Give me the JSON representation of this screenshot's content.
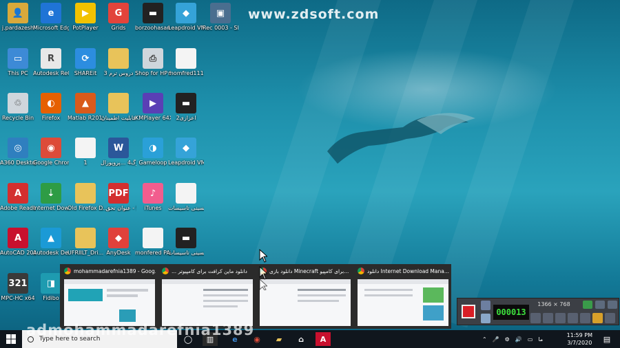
{
  "watermark": "www.zdsoft.com",
  "overlay_text": "admohammadarefnia1389",
  "desktop_icons": [
    {
      "label": "j.pardazesh",
      "icon": "user-folder-icon",
      "color": "#d9a93b",
      "glyph": "👤"
    },
    {
      "label": "Microsoft Edge",
      "icon": "edge-icon",
      "color": "#1f74d6",
      "glyph": "e"
    },
    {
      "label": "PotPlayer",
      "icon": "potplayer-icon",
      "color": "#f2c200",
      "glyph": "▶"
    },
    {
      "label": "Grids",
      "icon": "grids-icon",
      "color": "#e2443b",
      "glyph": "G"
    },
    {
      "label": "borzoohasan -94-11-5 ta...",
      "icon": "video-file-icon",
      "color": "#222222",
      "glyph": "▬"
    },
    {
      "label": "Leapdroid VM1",
      "icon": "leapdroid-icon",
      "color": "#35a3d8",
      "glyph": "◆"
    },
    {
      "label": "Rec 0003 - Shortcut",
      "icon": "recording-shortcut-icon",
      "color": "#4a6e8f",
      "glyph": "▣"
    },
    {
      "label": "This PC",
      "icon": "this-pc-icon",
      "color": "#3d8ad6",
      "glyph": "▭"
    },
    {
      "label": "Autodesk ReCap 360",
      "icon": "recap-icon",
      "color": "#e8e8e8",
      "glyph": "R"
    },
    {
      "label": "SHAREit",
      "icon": "shareit-icon",
      "color": "#2c8de0",
      "glyph": "⟳"
    },
    {
      "label": "دروس ترم 3",
      "icon": "folder-icon",
      "color": "#e8c35a",
      "glyph": ""
    },
    {
      "label": "Shop for HP Supplies",
      "icon": "printer-icon",
      "color": "#cfd6dc",
      "glyph": "⎙"
    },
    {
      "label": "momfred111 - Copy",
      "icon": "text-file-icon",
      "color": "#f4f4f4",
      "glyph": ""
    },
    {
      "label": "Recycle Bin",
      "icon": "recycle-bin-icon",
      "color": "#cfd6dc",
      "glyph": "♲"
    },
    {
      "label": "Firefox",
      "icon": "firefox-icon",
      "color": "#e66000",
      "glyph": "◐"
    },
    {
      "label": "Matlab R2019a",
      "icon": "matlab-icon",
      "color": "#d95a1b",
      "glyph": "▲"
    },
    {
      "label": "قابلیت اطمینان",
      "icon": "pdf-folder-icon",
      "color": "#e8c35a",
      "glyph": ""
    },
    {
      "label": "KMPlayer 64X",
      "icon": "kmplayer-icon",
      "color": "#5a3fb5",
      "glyph": "▶"
    },
    {
      "label": "اعزازی2",
      "icon": "video-file-icon",
      "color": "#222222",
      "glyph": "▬"
    },
    {
      "label": "A360 Desktop",
      "icon": "a360-icon",
      "color": "#2f7fbf",
      "glyph": "◎"
    },
    {
      "label": "Google Chrome",
      "icon": "chrome-icon",
      "color": "#dd4b39",
      "glyph": "◉"
    },
    {
      "label": "1",
      "icon": "blank-file-icon",
      "color": "#f4f4f4",
      "glyph": ""
    },
    {
      "label": "کاربرگ4 ...پروپوزال",
      "icon": "word-file-icon",
      "color": "#2b579a",
      "glyph": "W"
    },
    {
      "label": "Gameloop",
      "icon": "gameloop-icon",
      "color": "#2aa0d8",
      "glyph": "◑"
    },
    {
      "label": "Leapdroid VM2",
      "icon": "leapdroid-icon",
      "color": "#35a3d8",
      "glyph": "◆"
    },
    {
      "label": "Adobe Reader X",
      "icon": "adobe-reader-icon",
      "color": "#d32f2f",
      "glyph": "A"
    },
    {
      "label": "Internet Downlo...",
      "icon": "idm-icon",
      "color": "#2e9c45",
      "glyph": "⇣"
    },
    {
      "label": "Old Firefox Data",
      "icon": "folder-icon",
      "color": "#e8c35a",
      "glyph": ""
    },
    {
      "label": "...عنوان تحق - Shortcut",
      "icon": "pdf-shortcut-icon",
      "color": "#d32f2f",
      "glyph": "PDF"
    },
    {
      "label": "iTunes",
      "icon": "itunes-icon",
      "color": "#f25d8e",
      "glyph": "♪"
    },
    {
      "label": "اقای حسینی تاسیسات.bak",
      "icon": "blank-file-icon",
      "color": "#f4f4f4",
      "glyph": ""
    },
    {
      "label": "AutoCAD 2017 - E...",
      "icon": "autocad-icon",
      "color": "#c8102e",
      "glyph": "A"
    },
    {
      "label": "Autodesk Desktop App",
      "icon": "autodesk-app-icon",
      "color": "#1b9ad6",
      "glyph": "▲"
    },
    {
      "label": "UFRIILT_Dri...",
      "icon": "folder-icon",
      "color": "#e8c35a",
      "glyph": ""
    },
    {
      "label": "AnyDesk",
      "icon": "anydesk-icon",
      "color": "#e0413b",
      "glyph": "◆"
    },
    {
      "label": "monfered PARSIAN.bak",
      "icon": "blank-file-icon",
      "color": "#f4f4f4",
      "glyph": ""
    },
    {
      "label": "اقای حسینی تاسیسات",
      "icon": "video-file-icon",
      "color": "#222222",
      "glyph": "▬"
    },
    {
      "label": "MPC-HC x64",
      "icon": "mpc-hc-icon",
      "color": "#3a3a3a",
      "glyph": "321"
    },
    {
      "label": "Fidibo",
      "icon": "fidibo-icon",
      "color": "#1e9bb0",
      "glyph": "◨"
    }
  ],
  "task_view": [
    {
      "title": "mohammadarefnia1389 - Goog..."
    },
    {
      "title": "... دانلود ماین کرافت برای کامپیوتر"
    },
    {
      "title": "دانلود بازی Minecraft برای کامپیو..."
    },
    {
      "title": "دانلود Internet Download Mana..."
    }
  ],
  "recorder": {
    "time": "000013",
    "resolution": "1366 × 768"
  },
  "taskbar": {
    "search_placeholder": "Type here to search",
    "language": "ما",
    "time": "11:59 PM",
    "date": "3/7/2020"
  }
}
